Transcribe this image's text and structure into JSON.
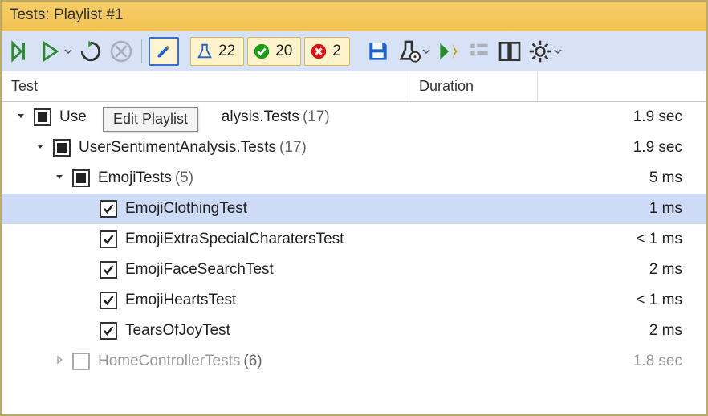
{
  "title": "Tests: Playlist #1",
  "tooltip": "Edit Playlist",
  "pills": {
    "total": "22",
    "pass": "20",
    "fail": "2"
  },
  "headers": {
    "test": "Test",
    "duration": "Duration"
  },
  "rows": [
    {
      "indent": 18,
      "expander": "down",
      "check": "filled",
      "label": "UserSentimentAnalysis.Tests",
      "count": "(17)",
      "duration": "1.9 sec",
      "obscured": true
    },
    {
      "indent": 42,
      "expander": "down",
      "check": "filled",
      "label": "UserSentimentAnalysis.Tests",
      "count": "(17)",
      "duration": "1.9 sec"
    },
    {
      "indent": 66,
      "expander": "down",
      "check": "filled",
      "label": "EmojiTests",
      "count": "(5)",
      "duration": "5 ms"
    },
    {
      "indent": 100,
      "expander": "none",
      "check": "checked",
      "label": "EmojiClothingTest",
      "duration": "1 ms",
      "selected": true
    },
    {
      "indent": 100,
      "expander": "none",
      "check": "checked",
      "label": "EmojiExtraSpecialCharatersTest",
      "duration": "< 1 ms"
    },
    {
      "indent": 100,
      "expander": "none",
      "check": "checked",
      "label": "EmojiFaceSearchTest",
      "duration": "2 ms"
    },
    {
      "indent": 100,
      "expander": "none",
      "check": "checked",
      "label": "EmojiHeartsTest",
      "duration": "< 1 ms"
    },
    {
      "indent": 100,
      "expander": "none",
      "check": "checked",
      "label": "TearsOfJoyTest",
      "duration": "2 ms"
    },
    {
      "indent": 66,
      "expander": "right",
      "check": "empty",
      "label": "HomeControllerTests",
      "count": "(6)",
      "duration": "1.8 sec",
      "disabled": true
    }
  ]
}
